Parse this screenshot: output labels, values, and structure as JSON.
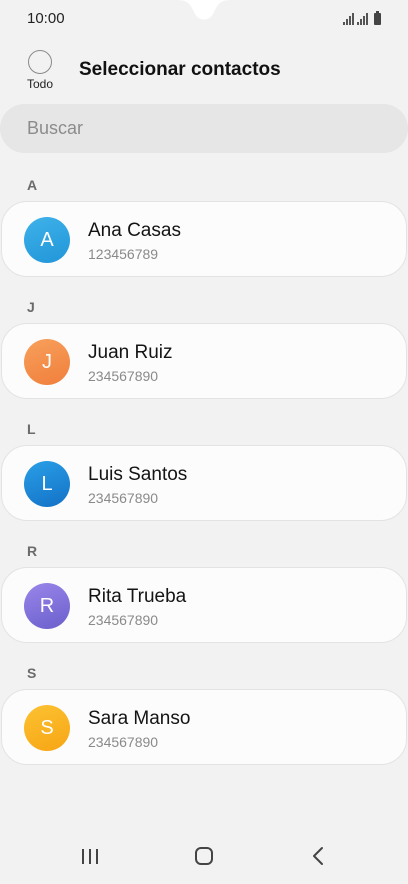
{
  "status_bar": {
    "time": "10:00"
  },
  "header": {
    "select_all_label": "Todo",
    "title": "Seleccionar contactos"
  },
  "search": {
    "placeholder": "Buscar"
  },
  "sections": [
    {
      "letter": "A",
      "contacts": [
        {
          "initial": "A",
          "name": "Ana Casas",
          "number": "123456789",
          "color_top": "#3fb2ea",
          "color_bottom": "#2196d8"
        }
      ]
    },
    {
      "letter": "J",
      "contacts": [
        {
          "initial": "J",
          "name": "Juan Ruiz",
          "number": "234567890",
          "color_top": "#f7a05c",
          "color_bottom": "#f07f3b"
        }
      ]
    },
    {
      "letter": "L",
      "contacts": [
        {
          "initial": "L",
          "name": "Luis Santos",
          "number": "234567890",
          "color_top": "#2a9fe6",
          "color_bottom": "#1371c7"
        }
      ]
    },
    {
      "letter": "R",
      "contacts": [
        {
          "initial": "R",
          "name": "Rita Trueba",
          "number": "234567890",
          "color_top": "#9a86ea",
          "color_bottom": "#6a5fcc"
        }
      ]
    },
    {
      "letter": "S",
      "contacts": [
        {
          "initial": "S",
          "name": "Sara Manso",
          "number": "234567890",
          "color_top": "#fcc232",
          "color_bottom": "#f7a514"
        }
      ]
    }
  ],
  "nav_bar": {
    "icons": [
      "recents-icon",
      "home-icon",
      "back-icon"
    ]
  }
}
